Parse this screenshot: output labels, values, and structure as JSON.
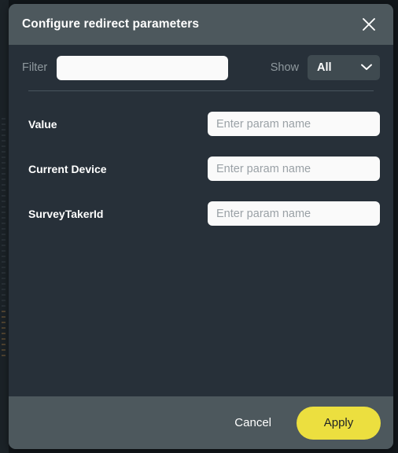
{
  "dialog": {
    "title": "Configure redirect parameters",
    "close_icon": "close-icon"
  },
  "filter": {
    "label": "Filter",
    "value": "",
    "placeholder": ""
  },
  "show": {
    "label": "Show",
    "selected": "All",
    "options": [
      "All"
    ],
    "chevron_icon": "chevron-down-icon"
  },
  "params": [
    {
      "label": "Value",
      "value": "",
      "placeholder": "Enter param name"
    },
    {
      "label": "Current Device",
      "value": "",
      "placeholder": "Enter param name"
    },
    {
      "label": "SurveyTakerId",
      "value": "",
      "placeholder": "Enter param name"
    }
  ],
  "footer": {
    "cancel_label": "Cancel",
    "apply_label": "Apply"
  },
  "colors": {
    "header_bg": "#4d585d",
    "body_bg": "#273039",
    "accent": "#ecdf3f",
    "input_bg": "#fafafa",
    "muted_text": "#8f999e"
  }
}
